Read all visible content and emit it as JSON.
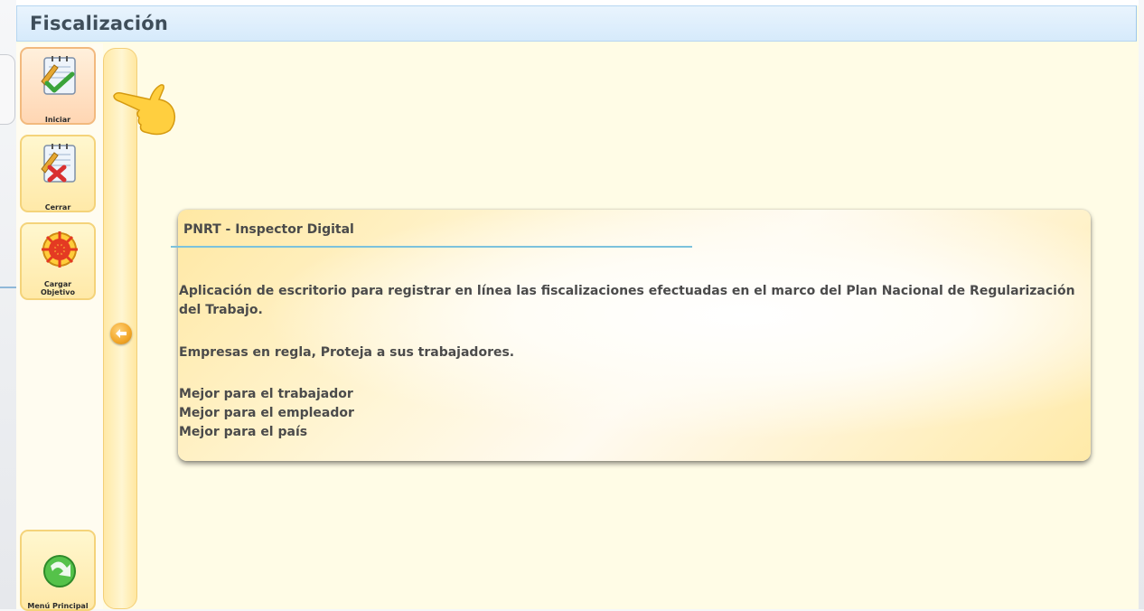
{
  "window": {
    "title": "Fiscalización"
  },
  "toolbar": {
    "items": [
      {
        "label": "Iniciar",
        "icon": "checklist-check-icon",
        "state": "active"
      },
      {
        "label": "Cerrar",
        "icon": "checklist-x-icon"
      },
      {
        "label": "Cargar Objetivo",
        "label_line1": "Cargar",
        "label_line2": "Objetivo",
        "icon": "target-icon"
      }
    ],
    "main_menu": {
      "label": "Menú Principal",
      "icon": "green-arrow-icon"
    }
  },
  "card": {
    "title": "PNRT - Inspector Digital",
    "description": "Aplicación de escritorio para registrar en línea las fiscalizaciones efectuadas en el marco del Plan Nacional de Regularización del Trabajo.",
    "slogan": "Empresas en regla, Proteja a sus trabajadores.",
    "benefits": [
      "Mejor para el trabajador",
      "Mejor para el empleador",
      "Mejor para el país"
    ]
  },
  "colors": {
    "accent": "#7cc2dc",
    "panel": "#fffce6",
    "button_border": "#f4d37a",
    "title_bar": "#d6eafb"
  }
}
